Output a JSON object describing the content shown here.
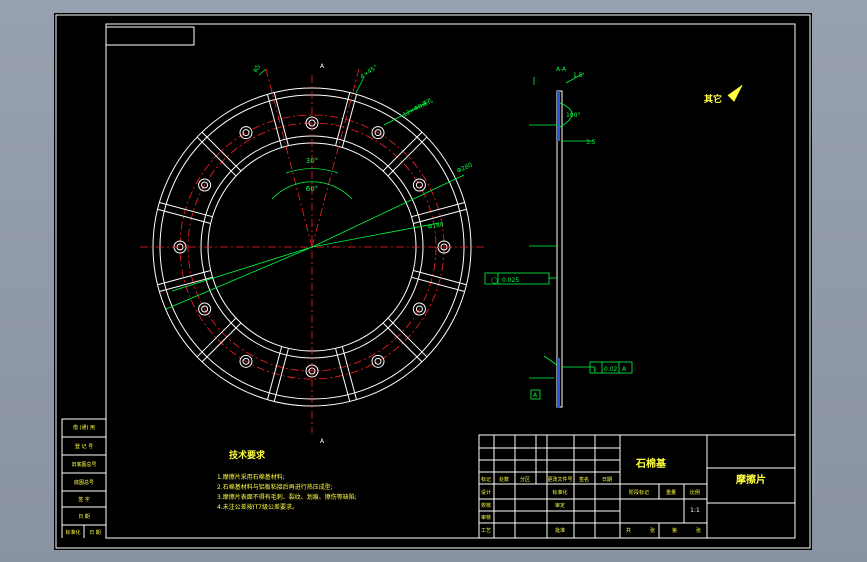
{
  "drawing": {
    "title_block": {
      "material": "石棉基",
      "part_name": "摩擦片",
      "header_labels": [
        "标记",
        "处数",
        "分区",
        "更改文件号",
        "签名",
        "日期"
      ],
      "row_labels": [
        "设计",
        "校核",
        "审核",
        "工艺"
      ],
      "mid_labels": [
        "标准化",
        "审定",
        "批准"
      ],
      "stage_label": "阶段标记",
      "weight_label": "重量",
      "scale_label": "比例",
      "scale_value": "1:1",
      "sheet_labels": [
        "共",
        "张",
        "第",
        "张"
      ]
    },
    "side_block": [
      "借 (通) 用",
      "登 记 号",
      "旧底图总号",
      "底图总号",
      "签 字",
      "日 期"
    ],
    "bottom_left": [
      "标准化",
      "日 期"
    ],
    "tech_requirements": {
      "heading": "技术要求",
      "items": [
        "1.摩擦片采用石棉基材料;",
        "2.石棉基材料与铝板粘接后再进行热压成型;",
        "3.摩擦片表面不得有毛刺、裂纹、划痕、擦伤等缺陷;",
        "4.未注公差按IT7级公差要求。"
      ]
    },
    "roughness_note": "其它",
    "section_label": "A-A",
    "annotations": {
      "angle_30": "30°",
      "angle_60": "60°",
      "dim_r": "R5",
      "chamfer": "4×45°",
      "hole_note": "12×Φ8通孔",
      "dim_d1": "Φ280",
      "dim_d2": "Φ180",
      "dim_1_5": "1.5",
      "dim_3_5": "3.5",
      "dim_100": "100°",
      "flatness": "0.025",
      "parallel": "0.02",
      "datum": "A",
      "view_a": "A"
    }
  },
  "colors": {
    "line": "#ffffff",
    "center": "#ff2020",
    "dimension": "#00ff40",
    "text": "#ffff40"
  }
}
